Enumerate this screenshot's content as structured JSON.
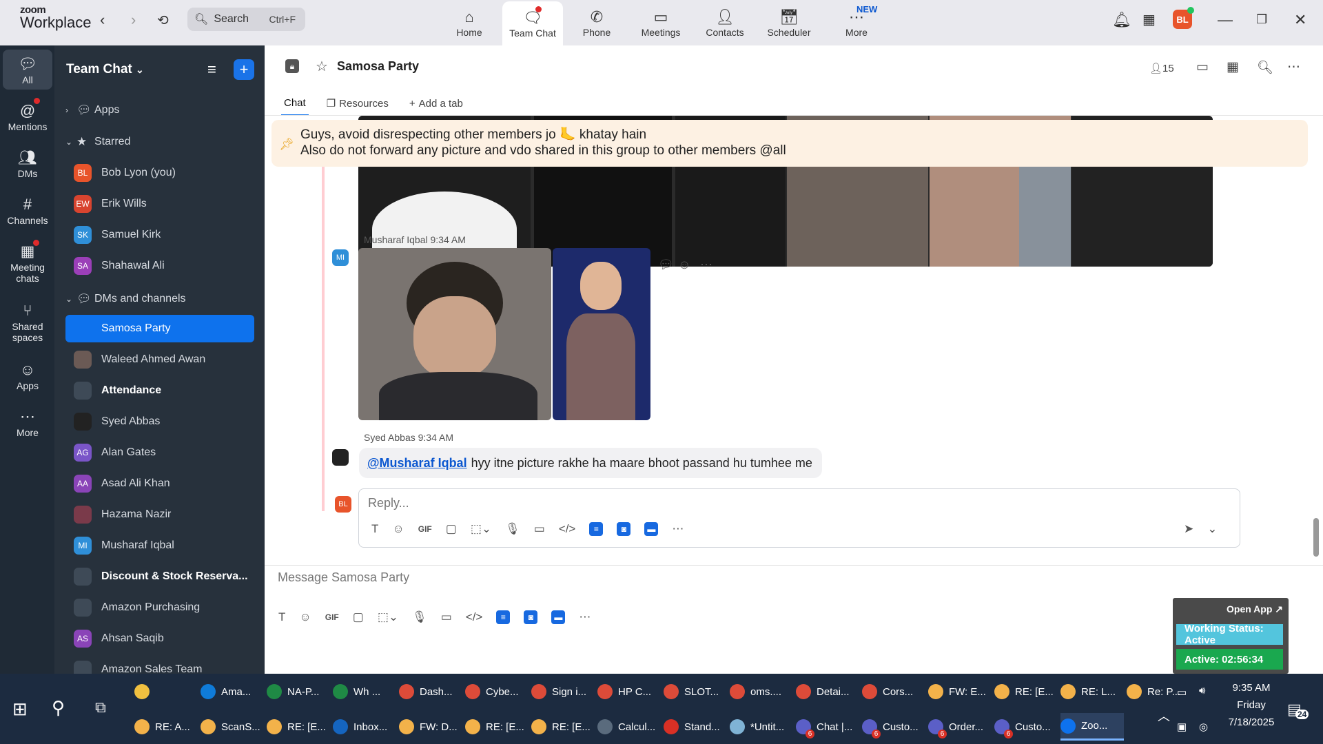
{
  "topbar": {
    "logo_line1": "zoom",
    "logo_line2": "Workplace",
    "search_label": "Search",
    "search_shortcut": "Ctrl+F",
    "tabs": [
      {
        "label": "Home",
        "icon": "home-icon"
      },
      {
        "label": "Team Chat",
        "icon": "chat-icon"
      },
      {
        "label": "Phone",
        "icon": "phone-icon"
      },
      {
        "label": "Meetings",
        "icon": "video-icon"
      },
      {
        "label": "Contacts",
        "icon": "contacts-icon"
      },
      {
        "label": "Scheduler",
        "icon": "calendar-icon"
      },
      {
        "label": "More",
        "icon": "more-icon"
      }
    ],
    "new_badge": "NEW",
    "user_initials": "BL",
    "accent": "#0e72ed"
  },
  "rail": [
    {
      "label": "All",
      "icon": "chat-bubble-icon"
    },
    {
      "label": "Mentions",
      "icon": "at-icon"
    },
    {
      "label": "DMs",
      "icon": "people-icon"
    },
    {
      "label": "Channels",
      "icon": "hash-icon"
    },
    {
      "label": "Meeting chats",
      "icon": "calendar-icon"
    },
    {
      "label": "Shared spaces",
      "icon": "share-icon"
    },
    {
      "label": "Apps",
      "icon": "apps-icon"
    },
    {
      "label": "More",
      "icon": "ellipsis-icon"
    }
  ],
  "sidebar": {
    "title": "Team Chat",
    "sections": {
      "apps": "Apps",
      "starred": "Starred",
      "dms": "DMs and channels"
    },
    "starred": [
      {
        "name": "Bob Lyon (you)",
        "initials": "BL",
        "color": "#e8542b"
      },
      {
        "name": "Erik Wills",
        "initials": "EW",
        "color": "#d8442f"
      },
      {
        "name": "Samuel Kirk",
        "initials": "SK",
        "color": "#2f8fd8"
      },
      {
        "name": "Shahawal Ali",
        "initials": "SA",
        "color": "#9b3fb8"
      }
    ],
    "channels": [
      {
        "name": "Samosa Party",
        "initials": "",
        "color": "#0e72ed"
      },
      {
        "name": "Waleed Ahmed Awan",
        "initials": "",
        "color": "#6b5a55"
      },
      {
        "name": "Attendance",
        "initials": "",
        "color": "#3e4a57"
      },
      {
        "name": "Syed Abbas",
        "initials": "",
        "color": "#222"
      },
      {
        "name": "Alan Gates",
        "initials": "AG",
        "color": "#7a55c8"
      },
      {
        "name": "Asad Ali Khan",
        "initials": "AA",
        "color": "#8a44b8"
      },
      {
        "name": "Hazama Nazir",
        "initials": "",
        "color": "#7a3a4a"
      },
      {
        "name": "Musharaf Iqbal",
        "initials": "MI",
        "color": "#2f8fd8"
      },
      {
        "name": "Discount & Stock Reserva...",
        "initials": "",
        "color": "#3e4a57"
      },
      {
        "name": "Amazon Purchasing",
        "initials": "",
        "color": "#3e4a57"
      },
      {
        "name": "Ahsan Saqib",
        "initials": "AS",
        "color": "#8a44b8"
      },
      {
        "name": "Amazon Sales Team",
        "initials": "",
        "color": "#3e4a57"
      }
    ]
  },
  "channel": {
    "name": "Samosa Party",
    "member_count": "15",
    "tabs": [
      "Chat",
      "Resources",
      "Add a tab"
    ]
  },
  "pinned": {
    "line1": "Guys, avoid disrespecting other members jo 🦶 khatay hain",
    "line2": "Also do not forward any picture and vdo shared in this group to other members @all"
  },
  "messages": [
    {
      "sender": "Musharaf Iqbal",
      "time": "9:34 AM",
      "initials": "MI"
    },
    {
      "sender": "Syed Abbas",
      "time": "9:34 AM",
      "mention": "@Musharaf Iqbal",
      "text": "hyy itne picture rakhe ha maare bhoot passand hu tumhee me"
    }
  ],
  "reply": {
    "placeholder": "Reply...",
    "initials": "BL"
  },
  "composer": {
    "placeholder": "Message Samosa Party"
  },
  "status_widget": {
    "open_app": "Open App ↗",
    "working_status": "Working Status: Active",
    "active_timer": "Active: 02:56:34"
  },
  "taskbar": {
    "row1": [
      {
        "label": "",
        "color": "#f0c040"
      },
      {
        "label": "Ama...",
        "color": "#0f7bd8"
      },
      {
        "label": "NA-P...",
        "color": "#1f8a45"
      },
      {
        "label": "Wh ...",
        "color": "#1f8a45"
      },
      {
        "label": "Dash...",
        "color": "#dd4b39"
      },
      {
        "label": "Cybe...",
        "color": "#dd4b39"
      },
      {
        "label": "Sign i...",
        "color": "#dd4b39"
      },
      {
        "label": "HP C...",
        "color": "#dd4b39"
      },
      {
        "label": "SLOT...",
        "color": "#dd4b39"
      },
      {
        "label": "oms....",
        "color": "#dd4b39"
      },
      {
        "label": "Detai...",
        "color": "#dd4b39"
      },
      {
        "label": "Cors...",
        "color": "#dd4b39"
      },
      {
        "label": "FW: E...",
        "color": "#f3b24a"
      },
      {
        "label": "RE: [E...",
        "color": "#f3b24a"
      },
      {
        "label": "RE: L...",
        "color": "#f3b24a"
      },
      {
        "label": "Re: P...",
        "color": "#f3b24a"
      }
    ],
    "row2": [
      {
        "label": "RE: A...",
        "color": "#f3b24a"
      },
      {
        "label": "ScanS...",
        "color": "#f3b24a"
      },
      {
        "label": "RE: [E...",
        "color": "#f3b24a"
      },
      {
        "label": "Inbox...",
        "color": "#1565c0"
      },
      {
        "label": "FW: D...",
        "color": "#f3b24a"
      },
      {
        "label": "RE: [E...",
        "color": "#f3b24a"
      },
      {
        "label": "RE: [E...",
        "color": "#f3b24a"
      },
      {
        "label": "Calcul...",
        "color": "#5a6b7d"
      },
      {
        "label": "Stand...",
        "color": "#d93025"
      },
      {
        "label": "*Untit...",
        "color": "#7fb3d5"
      },
      {
        "label": "Chat |...",
        "color": "#5b5fc7",
        "count": "6"
      },
      {
        "label": "Custo...",
        "color": "#5b5fc7",
        "count": "6"
      },
      {
        "label": "Order...",
        "color": "#5b5fc7",
        "count": "6"
      },
      {
        "label": "Custo...",
        "color": "#5b5fc7",
        "count": "6"
      },
      {
        "label": "Zoo...",
        "color": "#0e72ed"
      }
    ],
    "time": "9:35 AM",
    "day": "Friday",
    "date": "7/18/2025",
    "notifications": "24"
  }
}
